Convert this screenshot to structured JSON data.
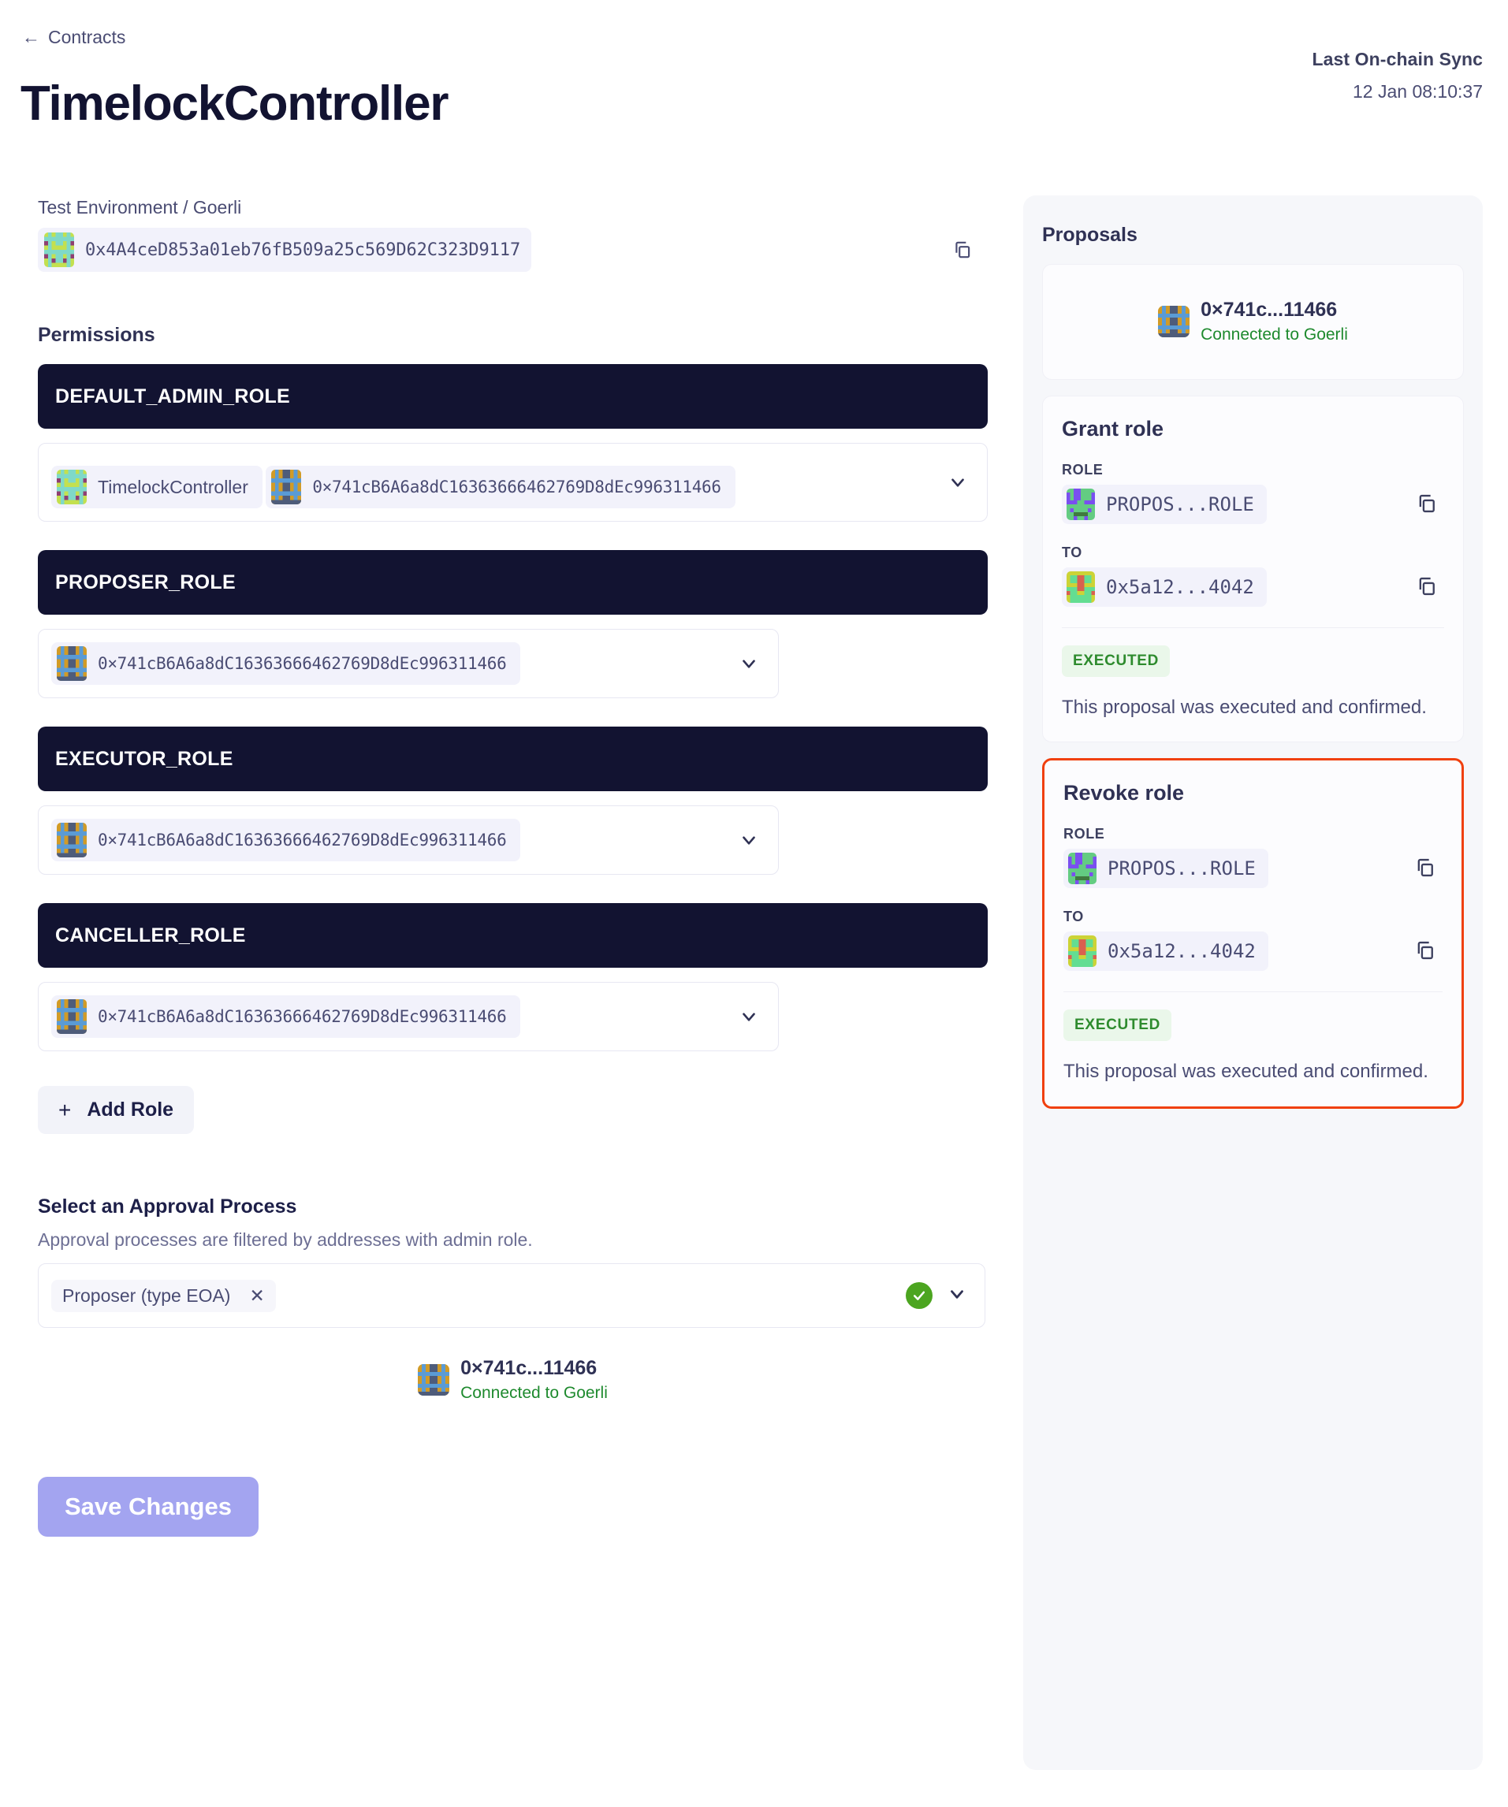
{
  "header": {
    "back_icon": "arrow-left-icon",
    "breadcrumb": "Contracts",
    "title": "TimelockController",
    "sync_label": "Last On-chain Sync",
    "sync_value": "12 Jan 08:10:37"
  },
  "contract": {
    "env_label": "Test Environment / Goerli",
    "address": "0x4A4ceD853a01eb76fB509a25c569D62C323D9117",
    "copy_icon": "copy-icon"
  },
  "permissions": {
    "heading": "Permissions",
    "roles": [
      {
        "name": "DEFAULT_ADMIN_ROLE",
        "members": [
          {
            "label": "TimelockController",
            "type": "name"
          },
          {
            "label": "0×741cB6A6a8dC16363666462769D8dEc996311466",
            "type": "address"
          }
        ]
      },
      {
        "name": "PROPOSER_ROLE",
        "members": [
          {
            "label": "0×741cB6A6a8dC16363666462769D8dEc996311466",
            "type": "address"
          }
        ]
      },
      {
        "name": "EXECUTOR_ROLE",
        "members": [
          {
            "label": "0×741cB6A6a8dC16363666462769D8dEc996311466",
            "type": "address"
          }
        ]
      },
      {
        "name": "CANCELLER_ROLE",
        "members": [
          {
            "label": "0×741cB6A6a8dC16363666462769D8dEc996311466",
            "type": "address"
          }
        ]
      }
    ],
    "add_role_label": "Add Role",
    "add_role_icon": "plus-icon"
  },
  "approval": {
    "heading": "Select an Approval Process",
    "subtext": "Approval processes are filtered by addresses with admin role.",
    "selected_chip": "Proposer (type EOA)",
    "remove_icon": "close-icon",
    "valid_icon": "check-circle-icon",
    "chevron_icon": "chevron-down-icon",
    "connected_name": "0×741c...11466",
    "connected_network": "Connected to Goerli"
  },
  "footer": {
    "save_label": "Save Changes",
    "save_color": "#a3a4f0"
  },
  "proposals_panel": {
    "title": "Proposals",
    "connected": {
      "name": "0×741c...11466",
      "network": "Connected to Goerli"
    },
    "cards": [
      {
        "title": "Grant role",
        "role_label": "ROLE",
        "role_value": "PROPOS...ROLE",
        "to_label": "TO",
        "to_value": "0x5a12...4042",
        "status": "EXECUTED",
        "description": "This proposal was executed and confirmed.",
        "highlighted": false
      },
      {
        "title": "Revoke role",
        "role_label": "ROLE",
        "role_value": "PROPOS...ROLE",
        "to_label": "TO",
        "to_value": "0x5a12...4042",
        "status": "EXECUTED",
        "description": "This proposal was executed and confirmed.",
        "highlighted": true
      }
    ],
    "highlight_color": "#f0400e",
    "status_color": "#2e8b2e",
    "copy_icon": "copy-icon"
  }
}
